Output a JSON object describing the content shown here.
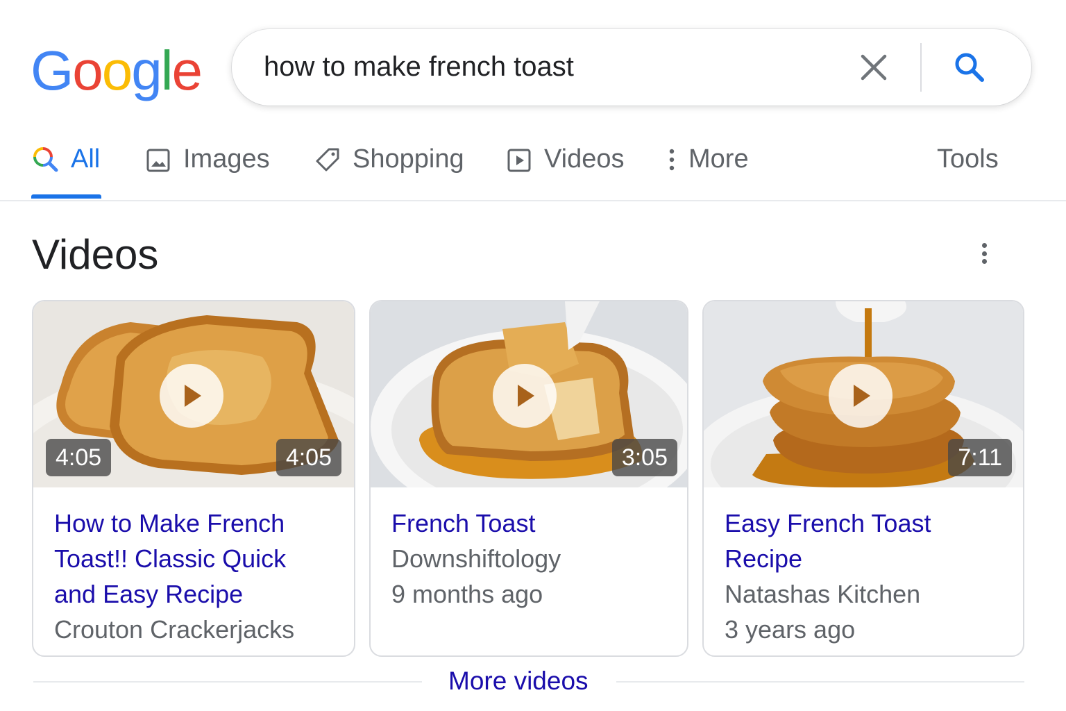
{
  "logo": {
    "letters": [
      {
        "char": "G",
        "color": "#4285F4"
      },
      {
        "char": "o",
        "color": "#EA4335"
      },
      {
        "char": "o",
        "color": "#FBBC05"
      },
      {
        "char": "g",
        "color": "#4285F4"
      },
      {
        "char": "l",
        "color": "#34A853"
      },
      {
        "char": "e",
        "color": "#EA4335"
      }
    ]
  },
  "search": {
    "query": "how to make french toast",
    "clear_icon": "close-icon",
    "search_icon": "search-icon"
  },
  "tabs": [
    {
      "label": "All",
      "icon": "search-icon",
      "active": true
    },
    {
      "label": "Images",
      "icon": "image-icon",
      "active": false
    },
    {
      "label": "Shopping",
      "icon": "tag-icon",
      "active": false
    },
    {
      "label": "Videos",
      "icon": "play-box-icon",
      "active": false
    },
    {
      "label": "More",
      "icon": "more-vert-icon",
      "active": false
    },
    {
      "label": "Tools",
      "icon": "",
      "active": false
    }
  ],
  "section": {
    "title": "Videos",
    "menu_icon": "more-vert-icon"
  },
  "videos": [
    {
      "title": "How to Make French Toast!! Classic Quick and Easy Recipe",
      "channel": "Crouton Crackerjacks",
      "age": "",
      "duration_left": "4:05",
      "duration": "4:05"
    },
    {
      "title": "French Toast",
      "channel": "Downshiftology",
      "age": "9 months ago",
      "duration": "3:05"
    },
    {
      "title": "Easy French Toast Recipe",
      "channel": "Natashas Kitchen",
      "age": "3 years ago",
      "duration": "7:11"
    }
  ],
  "more_videos": {
    "label": "More videos"
  },
  "colors": {
    "link": "#1a0dab",
    "accent": "#1a73e8",
    "secondary_text": "#5f6368"
  }
}
